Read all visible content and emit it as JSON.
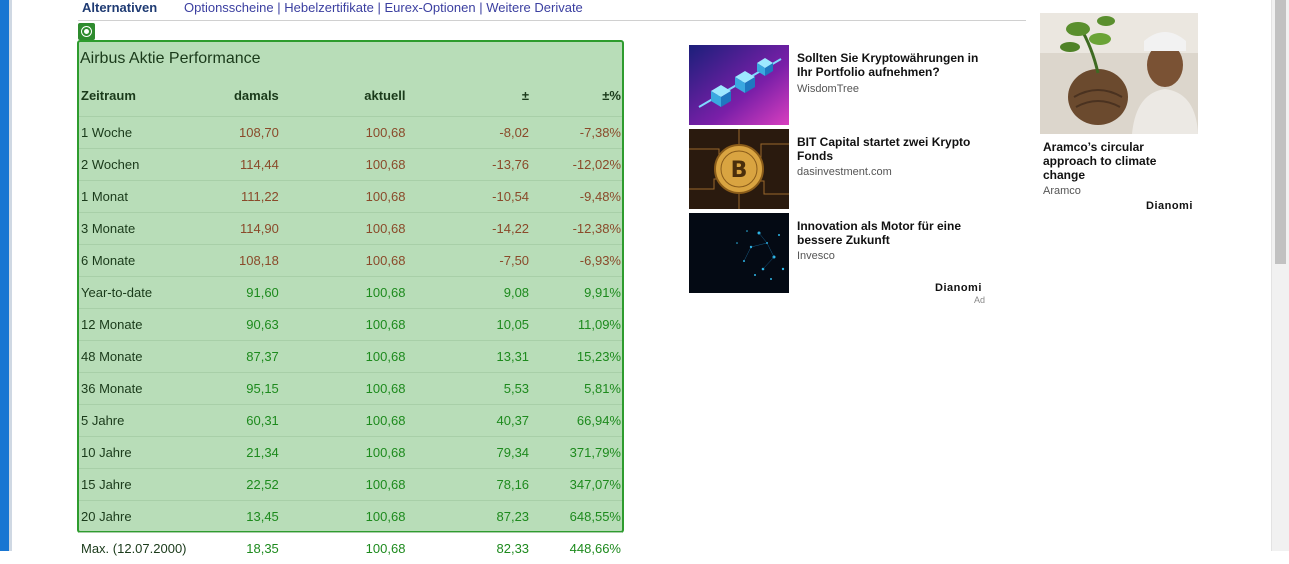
{
  "nav": {
    "active": "Alternativen",
    "links": [
      "Optionsscheine",
      "Hebelzertifikate",
      "Eurex-Optionen",
      "Weitere Derivate"
    ],
    "separator": "|"
  },
  "performance": {
    "title": "Airbus Aktie Performance",
    "headers": [
      "Zeitraum",
      "damals",
      "aktuell",
      "±",
      "±%"
    ],
    "rows": [
      {
        "period": "1 Woche",
        "then": "108,70",
        "now": "100,68",
        "diff": "-8,02",
        "pct": "-7,38%",
        "trend": "neg"
      },
      {
        "period": "2 Wochen",
        "then": "114,44",
        "now": "100,68",
        "diff": "-13,76",
        "pct": "-12,02%",
        "trend": "neg"
      },
      {
        "period": "1 Monat",
        "then": "111,22",
        "now": "100,68",
        "diff": "-10,54",
        "pct": "-9,48%",
        "trend": "neg"
      },
      {
        "period": "3 Monate",
        "then": "114,90",
        "now": "100,68",
        "diff": "-14,22",
        "pct": "-12,38%",
        "trend": "neg"
      },
      {
        "period": "6 Monate",
        "then": "108,18",
        "now": "100,68",
        "diff": "-7,50",
        "pct": "-6,93%",
        "trend": "neg"
      },
      {
        "period": "Year-to-date",
        "then": "91,60",
        "now": "100,68",
        "diff": "9,08",
        "pct": "9,91%",
        "trend": "pos"
      },
      {
        "period": "12 Monate",
        "then": "90,63",
        "now": "100,68",
        "diff": "10,05",
        "pct": "11,09%",
        "trend": "pos"
      },
      {
        "period": "48 Monate",
        "then": "87,37",
        "now": "100,68",
        "diff": "13,31",
        "pct": "15,23%",
        "trend": "pos"
      },
      {
        "period": "36 Monate",
        "then": "95,15",
        "now": "100,68",
        "diff": "5,53",
        "pct": "5,81%",
        "trend": "pos"
      },
      {
        "period": "5 Jahre",
        "then": "60,31",
        "now": "100,68",
        "diff": "40,37",
        "pct": "66,94%",
        "trend": "pos"
      },
      {
        "period": "10 Jahre",
        "then": "21,34",
        "now": "100,68",
        "diff": "79,34",
        "pct": "371,79%",
        "trend": "pos"
      },
      {
        "period": "15 Jahre",
        "then": "22,52",
        "now": "100,68",
        "diff": "78,16",
        "pct": "347,07%",
        "trend": "pos"
      },
      {
        "period": "20 Jahre",
        "then": "13,45",
        "now": "100,68",
        "diff": "87,23",
        "pct": "648,55%",
        "trend": "pos"
      },
      {
        "period": "Max. (12.07.2000)",
        "then": "18,35",
        "now": "100,68",
        "diff": "82,33",
        "pct": "448,66%",
        "trend": "pos"
      }
    ]
  },
  "ads": [
    {
      "title": "Sollten Sie Kryptowährungen in Ihr Portfolio aufnehmen?",
      "source": "WisdomTree",
      "image": "crypto-cubes-image"
    },
    {
      "title": "BIT Capital startet zwei Krypto Fonds",
      "source": "dasinvestment.com",
      "image": "bitcoin-coin-image"
    },
    {
      "title": "Innovation als Motor für eine bessere Zukunft",
      "source": "Invesco",
      "image": "tech-particles-image"
    }
  ],
  "ad_brand": "Dianomi",
  "ad_label": "Ad",
  "side_ad": {
    "title": "Aramco’s circular approach to climate change",
    "source": "Aramco",
    "brand": "Dianomi",
    "image": "farmer-plant-image"
  },
  "colors": {
    "box_bg": "#b8ddb8",
    "box_border": "#2e9c2e",
    "negative": "#8a4a2a",
    "positive": "#1d8a1d",
    "link": "#3b3fa0",
    "accent": "#1976d2"
  }
}
